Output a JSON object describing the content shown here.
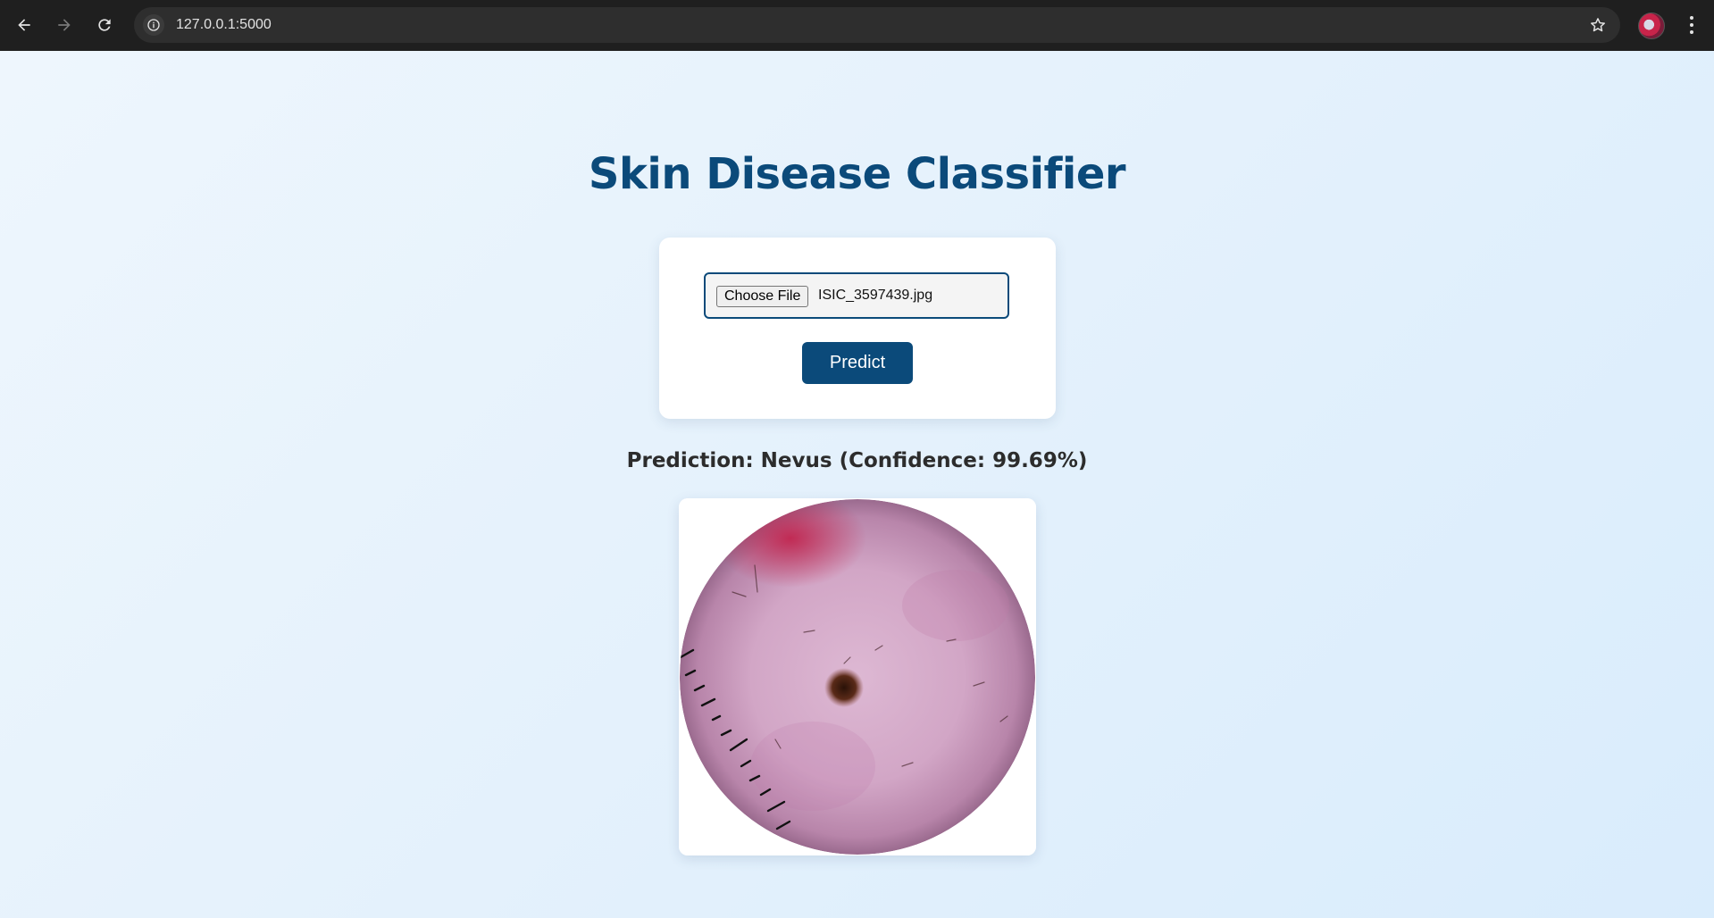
{
  "browser": {
    "url": "127.0.0.1:5000",
    "icons": {
      "back": "back-arrow-icon",
      "forward": "forward-arrow-icon",
      "reload": "reload-icon",
      "site_info": "info-icon",
      "bookmark": "star-icon",
      "profile": "avatar",
      "menu": "more-vert-icon"
    }
  },
  "page": {
    "title": "Skin Disease Classifier",
    "upload": {
      "button_label": "Choose File",
      "file_name": "ISIC_3597439.jpg"
    },
    "predict_label": "Predict",
    "prediction_text": "Prediction: Nevus (Confidence: 99.69%)"
  },
  "colors": {
    "accent": "#0b4a7a",
    "background_start": "#eef6fd",
    "background_end": "#d9ecfc"
  }
}
